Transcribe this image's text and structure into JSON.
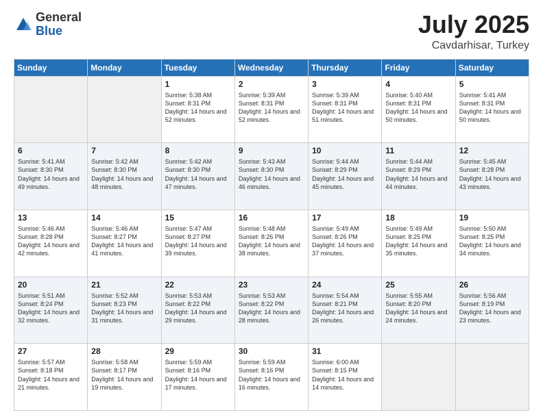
{
  "header": {
    "logo_line1": "General",
    "logo_line2": "Blue",
    "month_year": "July 2025",
    "location": "Cavdarhisar, Turkey"
  },
  "weekdays": [
    "Sunday",
    "Monday",
    "Tuesday",
    "Wednesday",
    "Thursday",
    "Friday",
    "Saturday"
  ],
  "weeks": [
    [
      {
        "day": "",
        "empty": true
      },
      {
        "day": "",
        "empty": true
      },
      {
        "day": "1",
        "sunrise": "Sunrise: 5:38 AM",
        "sunset": "Sunset: 8:31 PM",
        "daylight": "Daylight: 14 hours and 52 minutes."
      },
      {
        "day": "2",
        "sunrise": "Sunrise: 5:39 AM",
        "sunset": "Sunset: 8:31 PM",
        "daylight": "Daylight: 14 hours and 52 minutes."
      },
      {
        "day": "3",
        "sunrise": "Sunrise: 5:39 AM",
        "sunset": "Sunset: 8:31 PM",
        "daylight": "Daylight: 14 hours and 51 minutes."
      },
      {
        "day": "4",
        "sunrise": "Sunrise: 5:40 AM",
        "sunset": "Sunset: 8:31 PM",
        "daylight": "Daylight: 14 hours and 50 minutes."
      },
      {
        "day": "5",
        "sunrise": "Sunrise: 5:41 AM",
        "sunset": "Sunset: 8:31 PM",
        "daylight": "Daylight: 14 hours and 50 minutes."
      }
    ],
    [
      {
        "day": "6",
        "sunrise": "Sunrise: 5:41 AM",
        "sunset": "Sunset: 8:30 PM",
        "daylight": "Daylight: 14 hours and 49 minutes."
      },
      {
        "day": "7",
        "sunrise": "Sunrise: 5:42 AM",
        "sunset": "Sunset: 8:30 PM",
        "daylight": "Daylight: 14 hours and 48 minutes."
      },
      {
        "day": "8",
        "sunrise": "Sunrise: 5:42 AM",
        "sunset": "Sunset: 8:30 PM",
        "daylight": "Daylight: 14 hours and 47 minutes."
      },
      {
        "day": "9",
        "sunrise": "Sunrise: 5:43 AM",
        "sunset": "Sunset: 8:30 PM",
        "daylight": "Daylight: 14 hours and 46 minutes."
      },
      {
        "day": "10",
        "sunrise": "Sunrise: 5:44 AM",
        "sunset": "Sunset: 8:29 PM",
        "daylight": "Daylight: 14 hours and 45 minutes."
      },
      {
        "day": "11",
        "sunrise": "Sunrise: 5:44 AM",
        "sunset": "Sunset: 8:29 PM",
        "daylight": "Daylight: 14 hours and 44 minutes."
      },
      {
        "day": "12",
        "sunrise": "Sunrise: 5:45 AM",
        "sunset": "Sunset: 8:28 PM",
        "daylight": "Daylight: 14 hours and 43 minutes."
      }
    ],
    [
      {
        "day": "13",
        "sunrise": "Sunrise: 5:46 AM",
        "sunset": "Sunset: 8:28 PM",
        "daylight": "Daylight: 14 hours and 42 minutes."
      },
      {
        "day": "14",
        "sunrise": "Sunrise: 5:46 AM",
        "sunset": "Sunset: 8:27 PM",
        "daylight": "Daylight: 14 hours and 41 minutes."
      },
      {
        "day": "15",
        "sunrise": "Sunrise: 5:47 AM",
        "sunset": "Sunset: 8:27 PM",
        "daylight": "Daylight: 14 hours and 39 minutes."
      },
      {
        "day": "16",
        "sunrise": "Sunrise: 5:48 AM",
        "sunset": "Sunset: 8:26 PM",
        "daylight": "Daylight: 14 hours and 38 minutes."
      },
      {
        "day": "17",
        "sunrise": "Sunrise: 5:49 AM",
        "sunset": "Sunset: 8:26 PM",
        "daylight": "Daylight: 14 hours and 37 minutes."
      },
      {
        "day": "18",
        "sunrise": "Sunrise: 5:49 AM",
        "sunset": "Sunset: 8:25 PM",
        "daylight": "Daylight: 14 hours and 35 minutes."
      },
      {
        "day": "19",
        "sunrise": "Sunrise: 5:50 AM",
        "sunset": "Sunset: 8:25 PM",
        "daylight": "Daylight: 14 hours and 34 minutes."
      }
    ],
    [
      {
        "day": "20",
        "sunrise": "Sunrise: 5:51 AM",
        "sunset": "Sunset: 8:24 PM",
        "daylight": "Daylight: 14 hours and 32 minutes."
      },
      {
        "day": "21",
        "sunrise": "Sunrise: 5:52 AM",
        "sunset": "Sunset: 8:23 PM",
        "daylight": "Daylight: 14 hours and 31 minutes."
      },
      {
        "day": "22",
        "sunrise": "Sunrise: 5:53 AM",
        "sunset": "Sunset: 8:22 PM",
        "daylight": "Daylight: 14 hours and 29 minutes."
      },
      {
        "day": "23",
        "sunrise": "Sunrise: 5:53 AM",
        "sunset": "Sunset: 8:22 PM",
        "daylight": "Daylight: 14 hours and 28 minutes."
      },
      {
        "day": "24",
        "sunrise": "Sunrise: 5:54 AM",
        "sunset": "Sunset: 8:21 PM",
        "daylight": "Daylight: 14 hours and 26 minutes."
      },
      {
        "day": "25",
        "sunrise": "Sunrise: 5:55 AM",
        "sunset": "Sunset: 8:20 PM",
        "daylight": "Daylight: 14 hours and 24 minutes."
      },
      {
        "day": "26",
        "sunrise": "Sunrise: 5:56 AM",
        "sunset": "Sunset: 8:19 PM",
        "daylight": "Daylight: 14 hours and 23 minutes."
      }
    ],
    [
      {
        "day": "27",
        "sunrise": "Sunrise: 5:57 AM",
        "sunset": "Sunset: 8:18 PM",
        "daylight": "Daylight: 14 hours and 21 minutes."
      },
      {
        "day": "28",
        "sunrise": "Sunrise: 5:58 AM",
        "sunset": "Sunset: 8:17 PM",
        "daylight": "Daylight: 14 hours and 19 minutes."
      },
      {
        "day": "29",
        "sunrise": "Sunrise: 5:59 AM",
        "sunset": "Sunset: 8:16 PM",
        "daylight": "Daylight: 14 hours and 17 minutes."
      },
      {
        "day": "30",
        "sunrise": "Sunrise: 5:59 AM",
        "sunset": "Sunset: 8:16 PM",
        "daylight": "Daylight: 14 hours and 16 minutes."
      },
      {
        "day": "31",
        "sunrise": "Sunrise: 6:00 AM",
        "sunset": "Sunset: 8:15 PM",
        "daylight": "Daylight: 14 hours and 14 minutes."
      },
      {
        "day": "",
        "empty": true
      },
      {
        "day": "",
        "empty": true
      }
    ]
  ]
}
